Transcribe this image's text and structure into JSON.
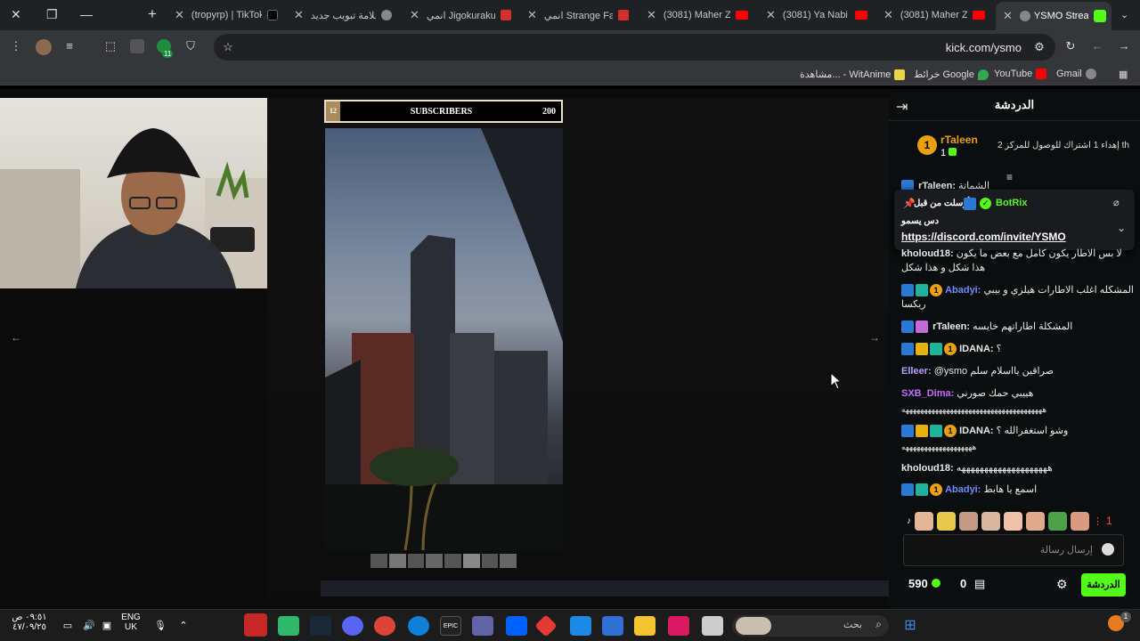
{
  "tabs": [
    {
      "title": "(3081) Maher Za",
      "favicon": "youtube-icon"
    },
    {
      "title": "(3081) Ya Nabi S",
      "favicon": "youtube-icon"
    },
    {
      "title": "(3081) Maher Za",
      "favicon": "youtube-icon"
    },
    {
      "title": "انمي Strange Fake",
      "favicon": "top-icon"
    },
    {
      "title": "انمي Jigokuraku",
      "favicon": "top-icon"
    },
    {
      "title": "علامة تبويب جديد",
      "favicon": "chrome-icon"
    },
    {
      "title": "(tropyrp) | TikTok",
      "favicon": "tiktok-icon"
    }
  ],
  "active_tab": {
    "title": "YSMO Stream",
    "favicon": "kick-icon"
  },
  "address": {
    "url": "kick.com/ysmo",
    "extension_badge": "11"
  },
  "bookmarks": [
    {
      "label": "Gmail",
      "icon": "gmail-icon"
    },
    {
      "label": "YouTube",
      "icon": "youtube-icon"
    },
    {
      "label": "خرائط Google",
      "icon": "maps-icon"
    },
    {
      "label": "مشاهدة... - WitAnime",
      "icon": "witanime-icon"
    }
  ],
  "stream": {
    "subscribers_label": "SUBSCRIBERS",
    "subscribers_current": "12",
    "subscribers_goal": "200",
    "subscribers_progress": 0.06
  },
  "chat": {
    "title": "الدردشة",
    "gift": {
      "user": "rTaleen",
      "count": "1",
      "text": "إهداء 1 اشتراك للوصول للمركز 2 th"
    },
    "pinned": {
      "pinned_label": "أرسلت من قبل",
      "user": "BotRix",
      "message": "دس يسمو",
      "link": "https://discord.com/invite/YSMO"
    },
    "partial_top": {
      "user": "rTaleen:",
      "text": "الشماتة"
    },
    "messages": [
      {
        "user": "kholoud18:",
        "text": "لا بس الاطار يكون كامل مع بعض ما يكون هذا شكل و هذا شكل",
        "color": "#e8e8e8"
      },
      {
        "user": "Abadyi:",
        "text": "المشكله اغلب الاطارات هيلزي و بيبي ريكسا",
        "color": "#6f8cff"
      },
      {
        "user": "rTaleen:",
        "text": "المشكلة اطاراتهم خايسه",
        "color": "#e8e8e8"
      },
      {
        "user": "IDANA:",
        "text": "؟",
        "color": "#e8e8e8"
      },
      {
        "user": "Elleer:",
        "text": "@ysmo صراقين يااسلام سلم",
        "color": "#b39cff"
      },
      {
        "user": "SXB_Dima:",
        "text": "هييبي حمك صورني",
        "color": "#c66bff"
      },
      {
        "user": "",
        "text": "ههههههههههههههههههههههههههههههههههههههه",
        "color": "#e8e8e8"
      },
      {
        "user": "IDANA:",
        "text": "وشو استغفرالله ؟",
        "color": "#e8e8e8"
      },
      {
        "user": "",
        "text": "هههههههههههههههههههه",
        "color": "#e8e8e8"
      },
      {
        "user": "kholoud18:",
        "text": "ههههههههههههههههههههه",
        "color": "#e8e8e8"
      },
      {
        "user": "Abadyi:",
        "text": "اسمع يا هابط",
        "color": "#6f8cff"
      }
    ],
    "emote_count": "1",
    "input_placeholder": "إرسال رسالة",
    "send_label": "الدردشة",
    "points": "590",
    "subs_count": "0"
  },
  "taskbar": {
    "search_placeholder": "بحث",
    "language": "ENG",
    "region": "UK",
    "time": "٠٩:٥١ ص",
    "date": "٤٧/٠٩/٢٥",
    "notification_count": "1"
  }
}
